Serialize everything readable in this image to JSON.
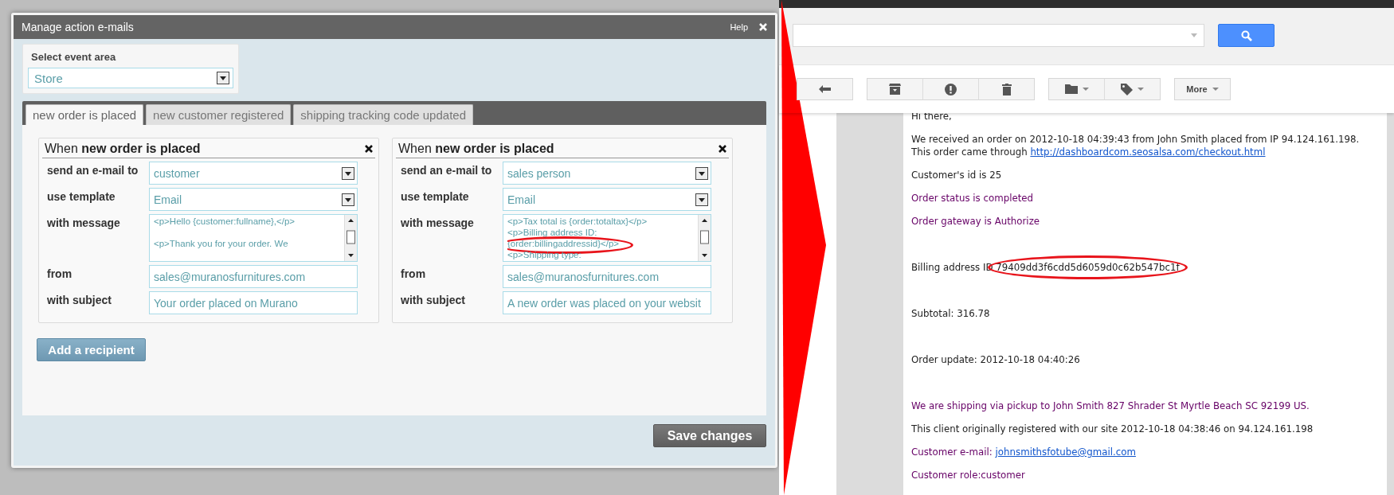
{
  "dialog": {
    "title": "Manage action e-mails",
    "help": "Help",
    "event_area": {
      "label": "Select event area",
      "value": "Store"
    },
    "tabs": [
      {
        "label": "new order is placed",
        "selected": true
      },
      {
        "label": "new customer registered",
        "selected": false
      },
      {
        "label": "shipping tracking code updated",
        "selected": false
      }
    ],
    "recipients": [
      {
        "title": "When **new order is placed**",
        "fields": [
          {
            "kind": "select",
            "label": "send an e-mail to",
            "value": "customer"
          },
          {
            "kind": "select",
            "label": "use template",
            "value": "Email"
          },
          {
            "kind": "message",
            "label": "with message",
            "lines": [
              {
                "text": "<p>Hello {customer:fullname},</p>\n\n<p>Thank you for your order. We"
              }
            ]
          },
          {
            "kind": "input",
            "label": "from",
            "value": "sales@muranosfurnitures.com"
          },
          {
            "kind": "input",
            "label": "with subject",
            "value": "Your order placed on Murano"
          }
        ]
      },
      {
        "title": "When **new order is placed**",
        "fields": [
          {
            "kind": "select",
            "label": "send an e-mail to",
            "value": "sales person"
          },
          {
            "kind": "select",
            "label": "use template",
            "value": "Email"
          },
          {
            "kind": "message",
            "label": "with message",
            "lines": [
              {
                "text": "<p>Tax total is {order:totaltax}</p>"
              },
              {
                "text": "<p>Billing address ID:"
              },
              {
                "text": "{order:billingaddressid}</p>",
                "circled": true
              },
              {
                "text": "<p>Shipping type:"
              }
            ]
          },
          {
            "kind": "input",
            "label": "from",
            "value": "sales@muranosfurnitures.com"
          },
          {
            "kind": "input",
            "label": "with subject",
            "value": "A new order was placed on your websit"
          }
        ]
      }
    ],
    "add_button": "Add a recipient",
    "save_button": "Save changes"
  },
  "mail": {
    "more_button": "More",
    "paragraphs": [
      {
        "text": "Hi there,",
        "color": "#222222"
      },
      {
        "text": "We received an order on 2012-10-18 04:39:43 from John Smith placed from IP 94.124.161.198. This order came through ",
        "link": "http://dashboardcom.seosalsa.com/checkout.html",
        "color": "#222222"
      },
      {
        "text": "Customer's id is 25",
        "color": "#222222"
      },
      {
        "text": "Order status is completed",
        "color": "#660066"
      },
      {
        "text": "Order gateway is Authorize",
        "color": "#660066"
      },
      {
        "text": "Billing address ID",
        "value": "79409dd3f6cdd5d6059d0c62b547bc1f",
        "color": "#222222",
        "circled": true
      },
      {
        "text": "Subtotal: 316.78",
        "color": "#222222"
      },
      {
        "text": "Order update: 2012-10-18 04:40:26",
        "color": "#222222"
      },
      {
        "text": "We are shipping via pickup to John Smith 827 Shrader St Myrtle Beach SC 92199 US.",
        "color": "#660066"
      },
      {
        "text": "This client originally registered with our site 2012-10-18 04:38:46 on 94.124.161.198",
        "color": "#222222"
      },
      {
        "text": "Customer e-mail: ",
        "link": "johnsmithsfotube@gmail.com",
        "color": "#660066"
      },
      {
        "text": "Customer role:customer",
        "color": "#660066"
      }
    ]
  }
}
